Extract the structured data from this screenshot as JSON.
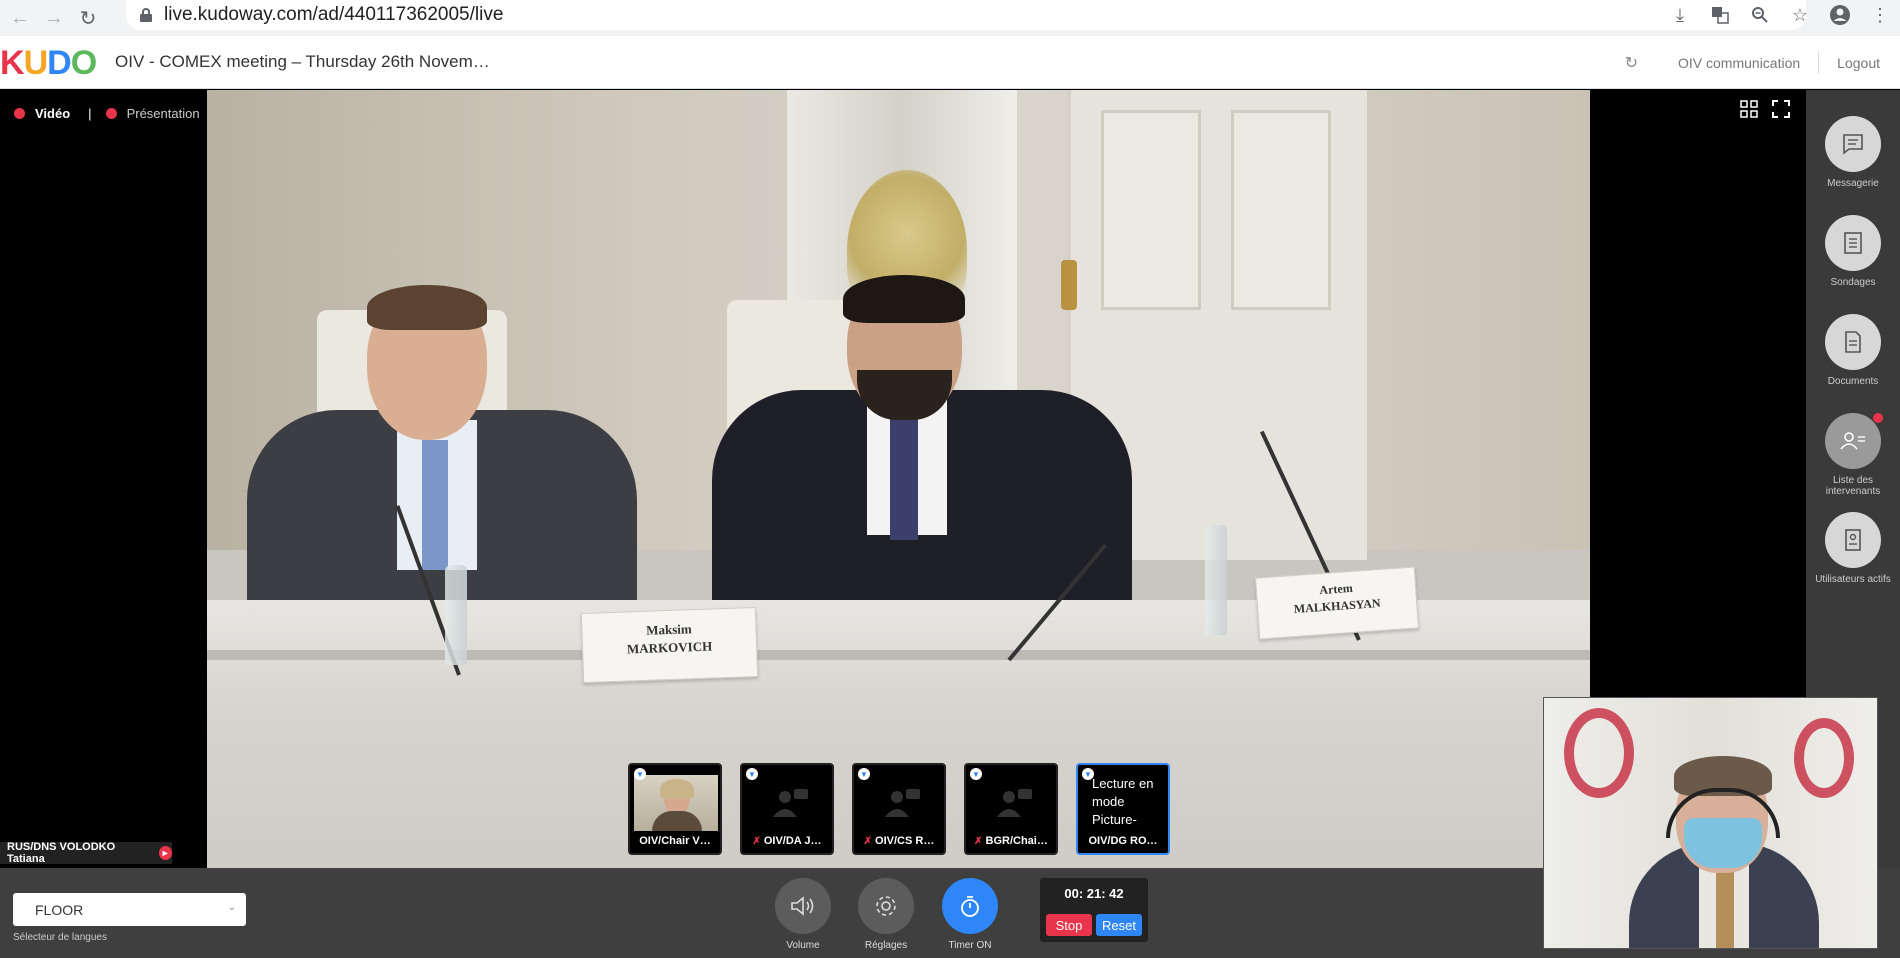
{
  "browser": {
    "url": "live.kudoway.com/ad/440117362005/live"
  },
  "header": {
    "logo_letters": [
      "K",
      "U",
      "D",
      "O"
    ],
    "logo_colors": [
      "#e8354b",
      "#f6a623",
      "#2f86f6",
      "#5cb85c"
    ],
    "meeting_title": "OIV - COMEX meeting – Thursday 26th Novem…",
    "communication_link": "OIV communication",
    "logout_link": "Logout"
  },
  "left_panel": {
    "tab_video": "Vidéo",
    "tab_separator": "|",
    "tab_presentation": "Présentation",
    "speaker_name": "RUS/DNS VOLODKO Tatiana"
  },
  "video": {
    "placard_left_line1": "Maksim",
    "placard_left_line2": "MARKOVICH",
    "placard_right_line1": "Artem",
    "placard_right_line2": "MALKHASYAN"
  },
  "sidebar": {
    "items": [
      {
        "label": "Messagerie",
        "icon": "chat-icon"
      },
      {
        "label": "Sondages",
        "icon": "poll-icon"
      },
      {
        "label": "Documents",
        "icon": "document-icon"
      },
      {
        "label": "Liste des intervenants",
        "icon": "speaker-list-icon"
      },
      {
        "label": "Utilisateurs actifs",
        "icon": "active-users-icon"
      }
    ]
  },
  "thumbnails": [
    {
      "name": "OIV/Chair V…",
      "has_video": true
    },
    {
      "name": "OIV/DA J…",
      "has_video": false
    },
    {
      "name": "OIV/CS R…",
      "has_video": false
    },
    {
      "name": "BGR/Chai…",
      "has_video": false
    },
    {
      "name": "OIV/DG RO…",
      "text": "Lecture en mode Picture-",
      "selected": true
    }
  ],
  "bottom_bar": {
    "language_value": "FLOOR",
    "language_label": "Sélecteur de langues",
    "volume_label": "Volume",
    "settings_label": "Réglages",
    "timer_label": "Timer ON",
    "timer_value": "00: 21: 42",
    "stop_label": "Stop",
    "reset_label": "Reset"
  },
  "colors": {
    "accent_blue": "#2f86f6",
    "accent_red": "#e8354b"
  }
}
